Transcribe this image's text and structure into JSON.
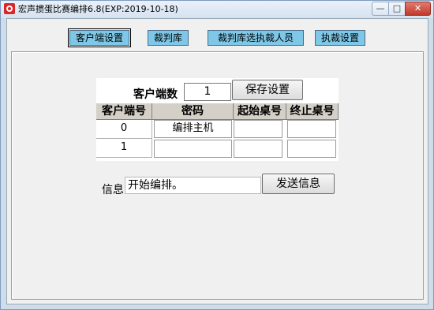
{
  "window": {
    "title": "宏声掼蛋比赛编排6.8(EXP:2019-10-18)",
    "controls": {
      "minimize": "—",
      "maximize": "□",
      "close": "✕"
    }
  },
  "tabs": [
    {
      "label": "客户端设置",
      "active": true
    },
    {
      "label": "裁判库",
      "active": false
    },
    {
      "label": "裁判库选执裁人员",
      "active": false
    },
    {
      "label": "执裁设置",
      "active": false
    }
  ],
  "settings": {
    "client_count_label": "客户端数",
    "client_count_value": "1",
    "save_button": "保存设置"
  },
  "table": {
    "headers": [
      "客户端号",
      "密码",
      "起始桌号",
      "终止桌号"
    ],
    "rows": [
      {
        "client_no": "0",
        "password": "编排主机",
        "start_table": "",
        "end_table": ""
      },
      {
        "client_no": "1",
        "password": "",
        "start_table": "",
        "end_table": ""
      }
    ]
  },
  "message": {
    "label": "信息",
    "value": "开始编排。",
    "send_button": "发送信息"
  },
  "colors": {
    "tab_background": "#7ec7e6",
    "window_frame": "#cfdcea",
    "close_button": "#c0392b"
  }
}
